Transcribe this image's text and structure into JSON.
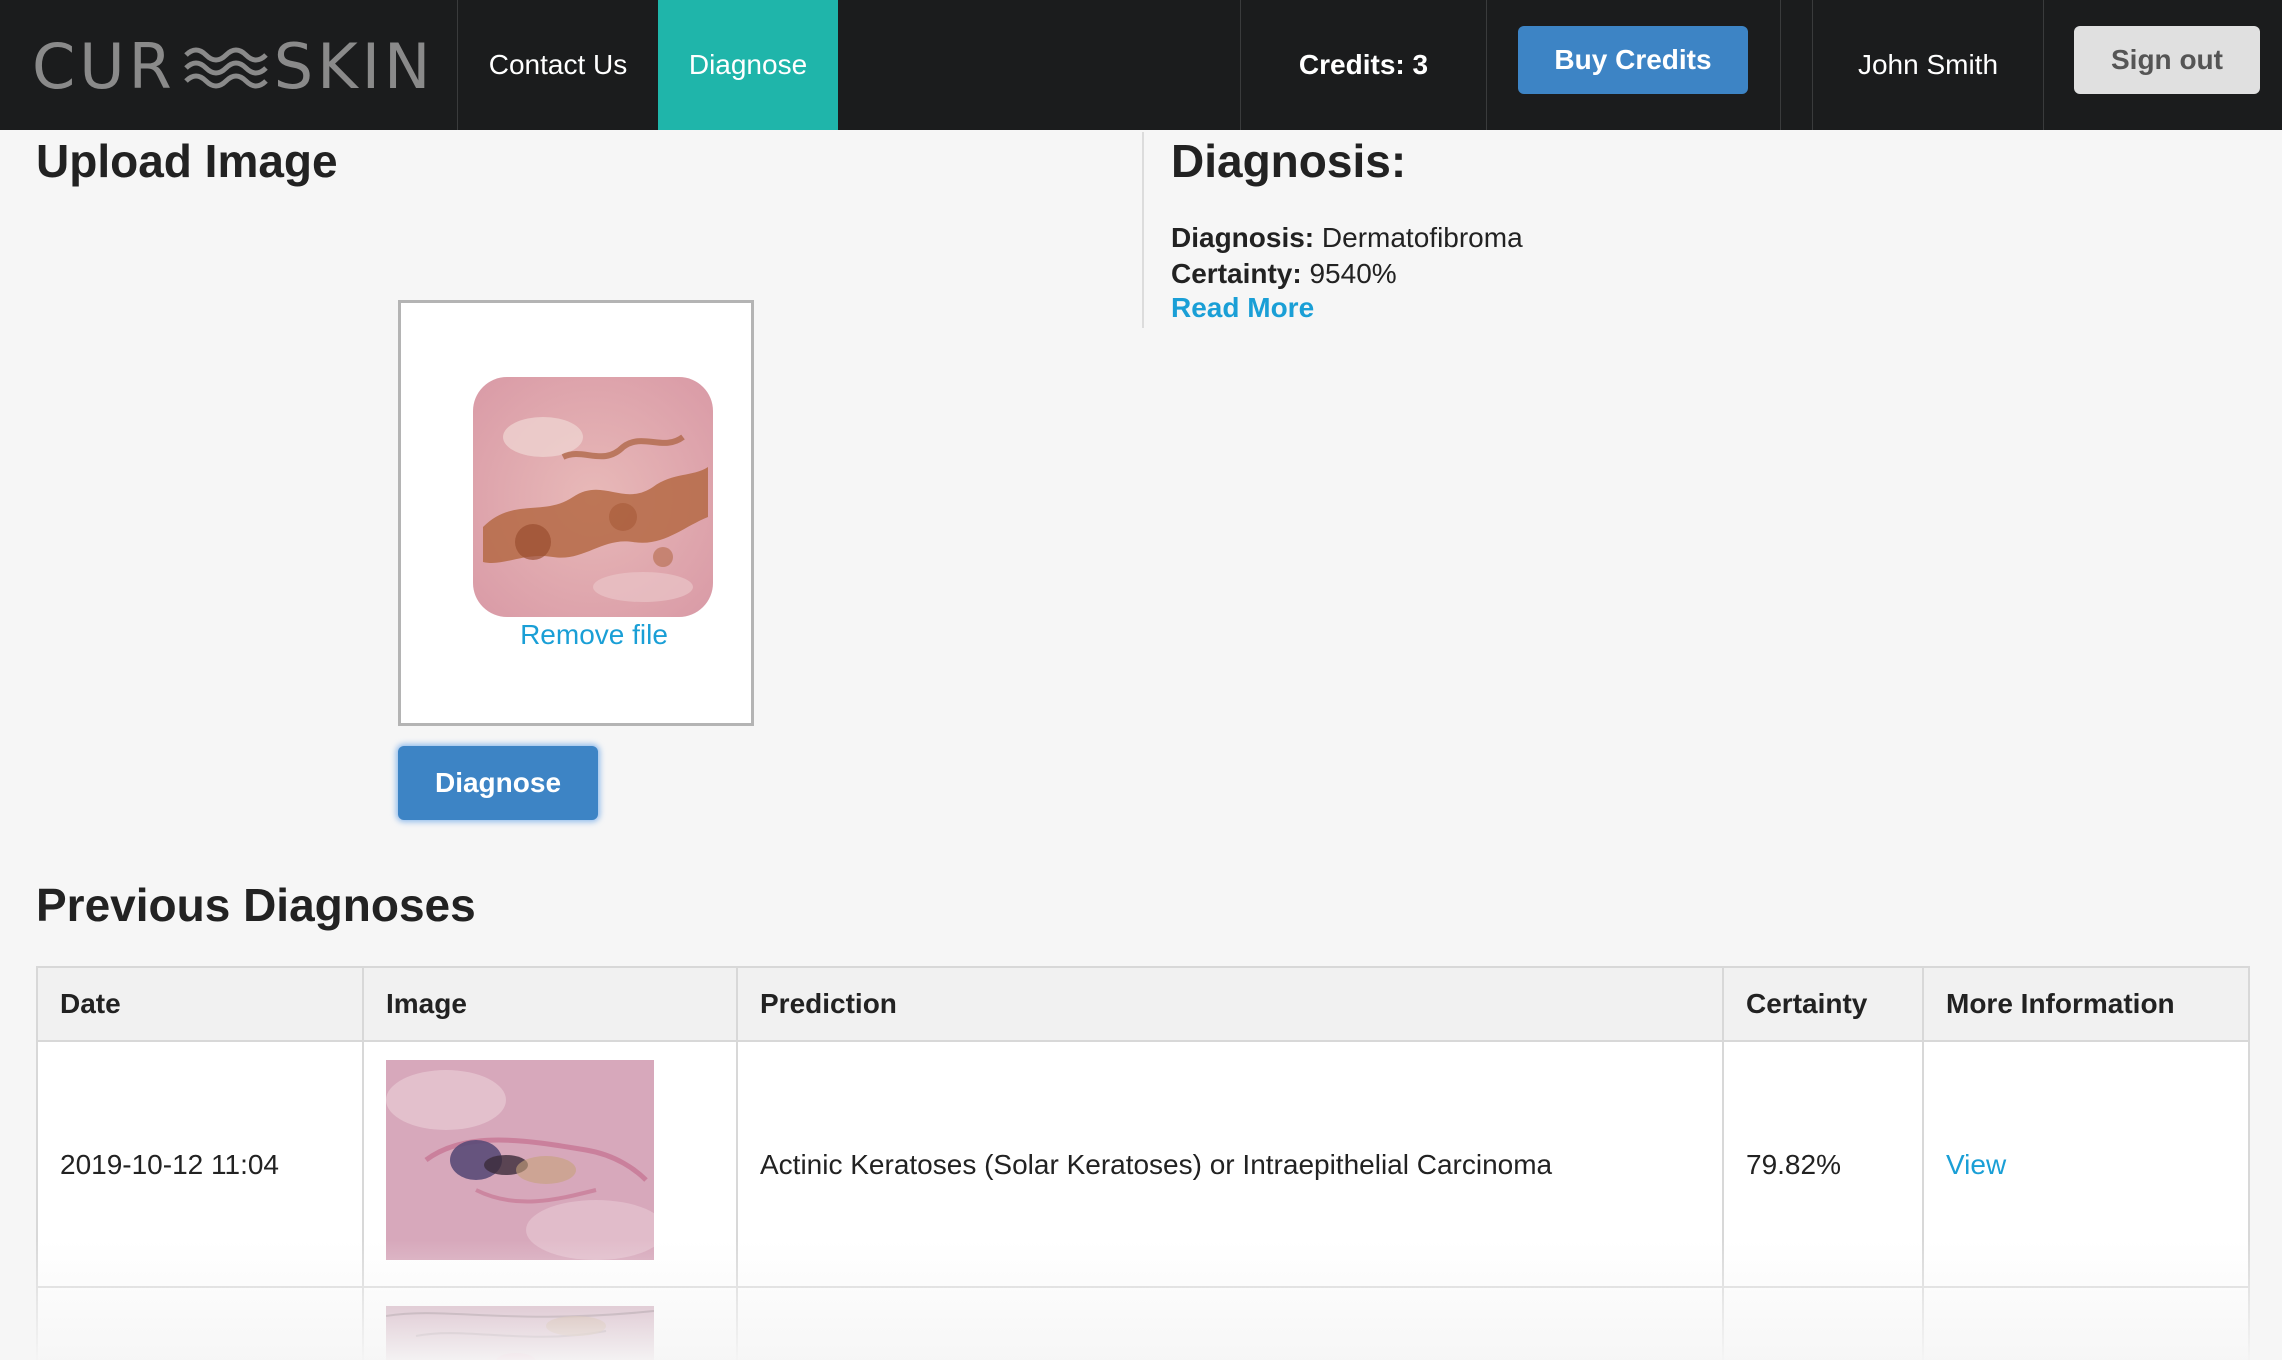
{
  "nav": {
    "logo_text_left": "CUR",
    "logo_text_right": "SKIN",
    "contact_label": "Contact Us",
    "diagnose_label": "Diagnose",
    "credits_label": "Credits: 3",
    "buy_label": "Buy Credits",
    "user_name": "John Smith",
    "signout_label": "Sign out",
    "active_color": "#1fb5aa",
    "button_color": "#3d84c5"
  },
  "upload": {
    "title": "Upload Image",
    "remove_label": "Remove file",
    "diagnose_button": "Diagnose"
  },
  "result": {
    "title": "Diagnosis:",
    "diagnosis_key": "Diagnosis:",
    "diagnosis_value": "Dermatofibroma",
    "certainty_key": "Certainty:",
    "certainty_value": "9540%",
    "read_more": "Read More"
  },
  "previous": {
    "title": "Previous Diagnoses",
    "columns": [
      "Date",
      "Image",
      "Prediction",
      "Certainty",
      "More Information"
    ],
    "rows": [
      {
        "date": "2019-10-12 11:04",
        "prediction": "Actinic Keratoses (Solar Keratoses) or Intraepithelial Carcinoma",
        "certainty": "79.82%",
        "link": "View"
      }
    ]
  },
  "icons": [
    "wave-logo-icon"
  ]
}
